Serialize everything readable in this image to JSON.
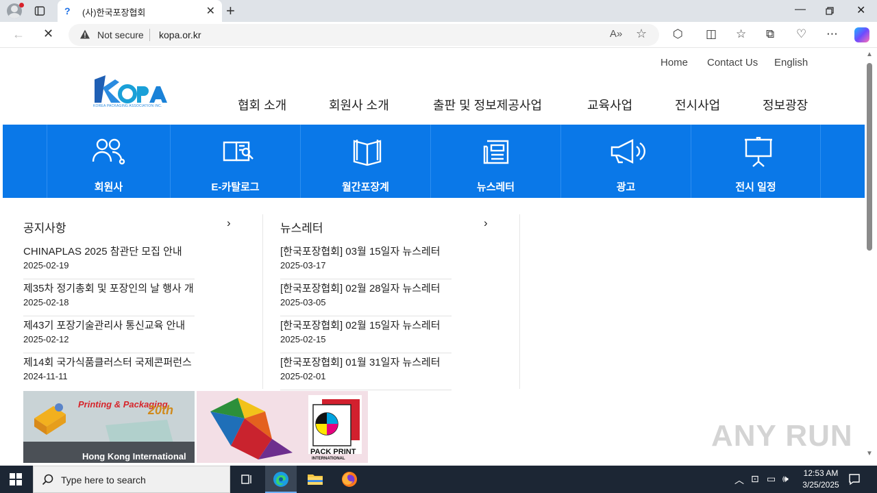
{
  "browser": {
    "tab_title": "(사)한국포장협회",
    "tab_favicon": "?",
    "not_secure_label": "Not secure",
    "url": "kopa.or.kr"
  },
  "site": {
    "logo_text": "KOPA",
    "logo_subtitle": "KOREA PACKAGING ASSOCIATION INC.",
    "top_links": [
      "Home",
      "Contact Us",
      "English"
    ],
    "main_nav": [
      "협회 소개",
      "회원사 소개",
      "출판 및 정보제공사업",
      "교육사업",
      "전시사업",
      "정보광장"
    ],
    "quick_menu": [
      {
        "label": "회원사",
        "icon": "members-icon"
      },
      {
        "label": "E-카탈로그",
        "icon": "e-catalog-icon"
      },
      {
        "label": "월간포장계",
        "icon": "book-icon"
      },
      {
        "label": "뉴스레터",
        "icon": "newsletter-icon"
      },
      {
        "label": "광고",
        "icon": "megaphone-icon"
      },
      {
        "label": "전시 일정",
        "icon": "presentation-board-icon"
      }
    ],
    "notices": {
      "title": "공지사항",
      "more": "›",
      "items": [
        {
          "title": "CHINAPLAS 2025 참관단 모집 안내",
          "date": "2025-02-19"
        },
        {
          "title": "제35차 정기총회 및 포장인의 날 행사 개",
          "date": "2025-02-18"
        },
        {
          "title": "제43기 포장기술관리사 통신교육 안내",
          "date": "2025-02-12"
        },
        {
          "title": "제14회 국가식품클러스터 국제콘퍼런스",
          "date": "2024-11-11"
        }
      ]
    },
    "newsletter": {
      "title": "뉴스레터",
      "more": "›",
      "items": [
        {
          "title": "[한국포장협회] 03월 15일자 뉴스레터",
          "date": "2025-03-17"
        },
        {
          "title": "[한국포장협회] 02월 28일자 뉴스레터",
          "date": "2025-03-05"
        },
        {
          "title": "[한국포장협회] 02월 15일자 뉴스레터",
          "date": "2025-02-15"
        },
        {
          "title": "[한국포장협회] 01월 31일자 뉴스레터",
          "date": "2025-02-01"
        }
      ]
    },
    "banners": [
      {
        "headline": "Printing & Packaging",
        "anniversary": "20th",
        "caption": "Hong Kong International"
      },
      {
        "caption_line1": "PACK PRINT",
        "caption_line2": "INTERNATIONAL"
      }
    ]
  },
  "watermark": "ANY RUN",
  "taskbar": {
    "search_placeholder": "Type here to search",
    "time": "12:53 AM",
    "date": "3/25/2025"
  },
  "colors": {
    "brand_blue": "#0a78e8",
    "taskbar": "#1c2634"
  }
}
